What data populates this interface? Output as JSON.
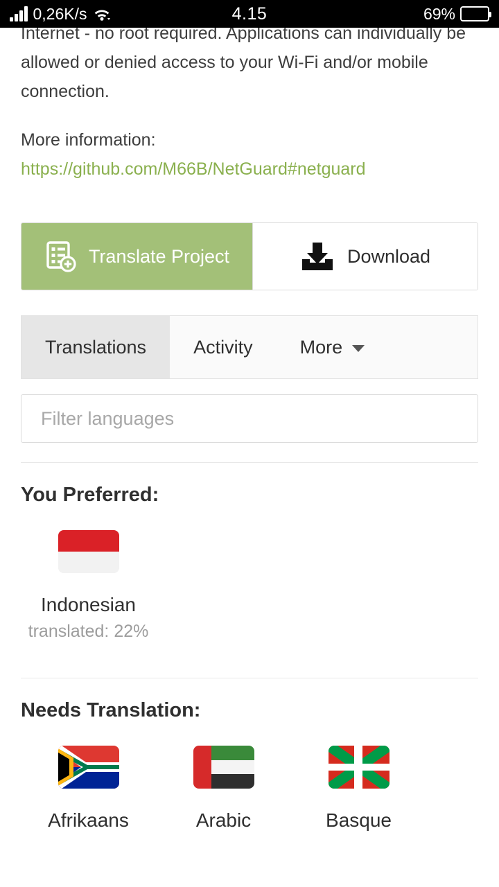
{
  "status_bar": {
    "network_speed": "0,26K/s",
    "signal_icon": "signal-bars-icon",
    "wifi_icon": "wifi-icon",
    "clock": "4.15",
    "battery_percent": "69%",
    "battery_level": 69,
    "battery_icon": "battery-icon",
    "background": "#000000"
  },
  "content": {
    "description_visible": "Internet - no root required. Applications can individually be allowed or denied access to your Wi-Fi and/or mobile connection.",
    "more_information_label": "More information:",
    "link_text": "https://github.com/M66B/NetGuard#netguard",
    "link_color": "#8ab04e"
  },
  "actions": {
    "translate": {
      "label": "Translate Project",
      "icon": "translate-project-icon",
      "background": "#a3c078",
      "text_color": "#ffffff"
    },
    "download": {
      "label": "Download",
      "icon": "download-icon",
      "background": "#ffffff",
      "text_color": "#2d2d2d"
    }
  },
  "tabs": {
    "items": [
      {
        "label": "Translations",
        "active": true
      },
      {
        "label": "Activity",
        "active": false
      },
      {
        "label": "More",
        "active": false,
        "has_caret": true
      }
    ]
  },
  "filter": {
    "value": "",
    "placeholder": "Filter languages"
  },
  "preferred": {
    "heading": "You Preferred:",
    "languages": [
      {
        "name": "Indonesian",
        "sub": "translated: 22%",
        "flag": "flag-indonesia-icon",
        "flag_colors": [
          "#da2127",
          "#f2f2f2"
        ]
      }
    ]
  },
  "needs_translation": {
    "heading": "Needs Translation:",
    "languages": [
      {
        "name": "Afrikaans",
        "flag": "flag-south-africa-icon",
        "flag_colors": [
          "#007a4d",
          "#de3831",
          "#002395",
          "#ffb612",
          "#000000",
          "#ffffff"
        ]
      },
      {
        "name": "Arabic",
        "flag": "flag-united-arab-emirates-icon",
        "flag_colors": [
          "#d62a2a",
          "#3a8a3a",
          "#f4f4f4",
          "#2e2e2e"
        ]
      },
      {
        "name": "Basque",
        "flag": "flag-basque-icon",
        "flag_colors": [
          "#d52b1e",
          "#009b48",
          "#ffffff"
        ]
      }
    ]
  }
}
